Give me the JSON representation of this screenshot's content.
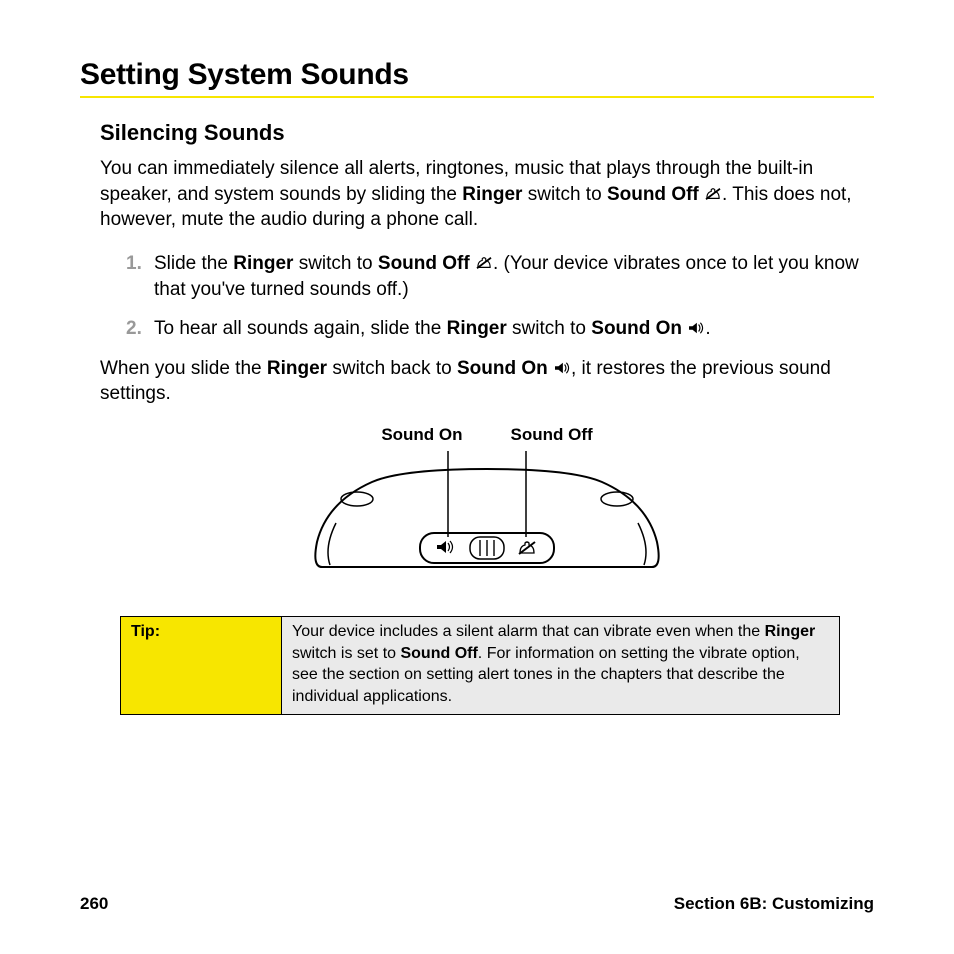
{
  "title": "Setting System Sounds",
  "subhead": "Silencing Sounds",
  "intro": {
    "pre": "You can immediately silence all alerts, ringtones, music that plays through the built-in speaker, and system sounds by sliding the ",
    "ringer": "Ringer",
    "mid1": " switch to ",
    "soundOff": "Sound Off",
    "post": ". This does not, however, mute the audio during a phone call."
  },
  "steps": {
    "s1": {
      "pre": "Slide the ",
      "ringer": "Ringer",
      "mid": " switch to ",
      "soundOff": "Sound Off",
      "post": ". (Your device vibrates once to let you know that you've turned sounds off.)"
    },
    "s2": {
      "pre": "To hear all sounds again, slide the ",
      "ringer": "Ringer",
      "mid": " switch to ",
      "soundOn": "Sound On",
      "post": "."
    }
  },
  "after": {
    "pre": "When you slide the ",
    "ringer": "Ringer",
    "mid": " switch back to ",
    "soundOn": "Sound On",
    "post": ", it restores the previous sound settings."
  },
  "diagram": {
    "labelOn": "Sound On",
    "labelOff": "Sound Off"
  },
  "tip": {
    "label": "Tip:",
    "pre": "Your device includes a silent alarm that can vibrate even when the ",
    "ringer": "Ringer",
    "mid": " switch is set to ",
    "soundOff": "Sound Off",
    "post": ". For information on setting the vibrate option, see the section on setting alert tones in the chapters that describe the individual applications."
  },
  "footer": {
    "page": "260",
    "section": "Section 6B: Customizing"
  }
}
